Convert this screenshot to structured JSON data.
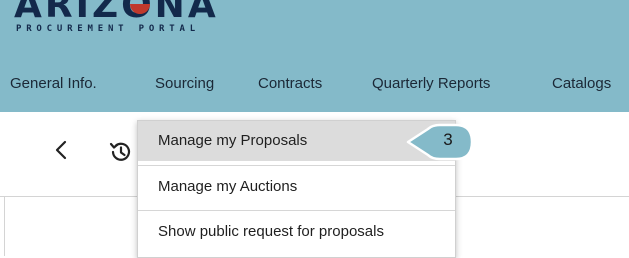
{
  "brand": {
    "logo_text": "ARIZONA",
    "logo_subtitle": "PROCUREMENT PORTAL",
    "header_color": "#84bac9"
  },
  "nav": {
    "items": [
      {
        "label": "General Info."
      },
      {
        "label": "Sourcing"
      },
      {
        "label": "Contracts"
      },
      {
        "label": "Quarterly Reports"
      },
      {
        "label": "Catalogs"
      }
    ],
    "active": "Sourcing"
  },
  "toolbar": {
    "back_icon": "chevron-left-icon",
    "history_icon": "history-icon"
  },
  "dropdown": {
    "items": [
      {
        "label": "Manage my Proposals",
        "highlighted": true
      },
      {
        "label": "Manage my Auctions",
        "highlighted": false
      },
      {
        "label": "Show public request for proposals",
        "highlighted": false
      }
    ]
  },
  "callout": {
    "number": "3",
    "color": "#84bac9"
  }
}
